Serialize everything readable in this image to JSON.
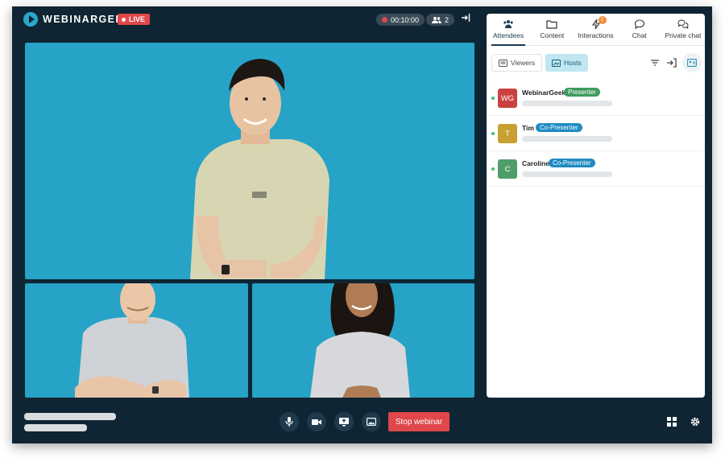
{
  "header": {
    "brand": "WEBINARGEEK",
    "live_label": "LIVE",
    "timer": "00:10:00",
    "participant_count": "2"
  },
  "controls": {
    "stop_label": "Stop webinar"
  },
  "panel": {
    "tabs": [
      {
        "label": "Attendees",
        "icon": "users-icon",
        "active": true
      },
      {
        "label": "Content",
        "icon": "folder-icon"
      },
      {
        "label": "Interactions",
        "icon": "lightning-icon",
        "badge": "2"
      },
      {
        "label": "Chat",
        "icon": "chat-bubble-icon"
      },
      {
        "label": "Private chat",
        "icon": "private-chat-icon"
      }
    ],
    "subtabs": {
      "viewers": "Viewers",
      "hosts": "Hosts"
    },
    "hosts": [
      {
        "initials": "WG",
        "name": "WebinarGeek",
        "role": "Presenter",
        "avatar_color": "#c9423f",
        "role_color": "#3f9b5e"
      },
      {
        "initials": "T",
        "name": "Tim",
        "role": "Co-Presenter",
        "avatar_color": "#c9a032",
        "role_color": "#1f8bc2"
      },
      {
        "initials": "C",
        "name": "Caroline",
        "role": "Co-Presenter",
        "avatar_color": "#4f9e6a",
        "role_color": "#1f8bc2"
      }
    ]
  },
  "colors": {
    "background": "#0f2533",
    "video_bg": "#26a3c7",
    "accent_red": "#e0474b"
  }
}
